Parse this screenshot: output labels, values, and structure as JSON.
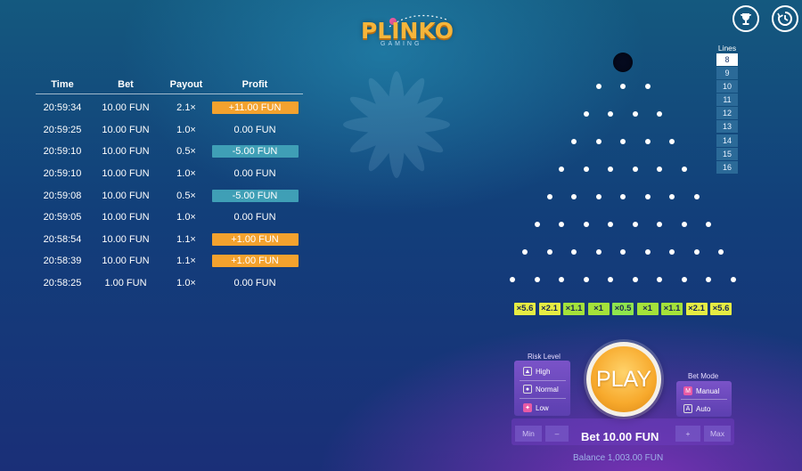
{
  "logo": {
    "title": "PLINKO",
    "subtitle": "GAMING"
  },
  "top_icons": [
    "trophy-icon",
    "history-icon"
  ],
  "history": {
    "headers": {
      "time": "Time",
      "bet": "Bet",
      "payout": "Payout",
      "profit": "Profit"
    },
    "rows": [
      {
        "time": "20:59:34",
        "bet": "10.00 FUN",
        "payout": "2.1×",
        "profit": "+11.00 FUN",
        "kind": "win"
      },
      {
        "time": "20:59:25",
        "bet": "10.00 FUN",
        "payout": "1.0×",
        "profit": "0.00 FUN",
        "kind": "none"
      },
      {
        "time": "20:59:10",
        "bet": "10.00 FUN",
        "payout": "0.5×",
        "profit": "-5.00 FUN",
        "kind": "loss"
      },
      {
        "time": "20:59:10",
        "bet": "10.00 FUN",
        "payout": "1.0×",
        "profit": "0.00 FUN",
        "kind": "none"
      },
      {
        "time": "20:59:08",
        "bet": "10.00 FUN",
        "payout": "0.5×",
        "profit": "-5.00 FUN",
        "kind": "loss"
      },
      {
        "time": "20:59:05",
        "bet": "10.00 FUN",
        "payout": "1.0×",
        "profit": "0.00 FUN",
        "kind": "none"
      },
      {
        "time": "20:58:54",
        "bet": "10.00 FUN",
        "payout": "1.1×",
        "profit": "+1.00 FUN",
        "kind": "win"
      },
      {
        "time": "20:58:39",
        "bet": "10.00 FUN",
        "payout": "1.1×",
        "profit": "+1.00 FUN",
        "kind": "win"
      },
      {
        "time": "20:58:25",
        "bet": "1.00 FUN",
        "payout": "1.0×",
        "profit": "0.00 FUN",
        "kind": "none"
      }
    ]
  },
  "board": {
    "rows": 8,
    "multipliers": [
      "×5.6",
      "×2.1",
      "×1.1",
      "×1",
      "×0.5",
      "×1",
      "×1.1",
      "×2.1",
      "×5.6"
    ]
  },
  "lines": {
    "title": "Lines",
    "options": [
      "8",
      "9",
      "10",
      "11",
      "12",
      "13",
      "14",
      "15",
      "16"
    ],
    "selected": "8"
  },
  "risk": {
    "title": "Risk Level",
    "options": [
      "High",
      "Normal",
      "Low"
    ]
  },
  "play_label": "PLAY",
  "bet_mode": {
    "title": "Bet Mode",
    "options": [
      "Manual",
      "Auto"
    ]
  },
  "controls": {
    "min": "Min",
    "minus": "–",
    "plus": "+",
    "max": "Max"
  },
  "bet_display": "Bet 10.00 FUN",
  "balance": "Balance 1,003.00 FUN",
  "colors": {
    "win": "#f3a22e",
    "loss": "#3f9fb6",
    "accent": "#f6b53a",
    "panel": "#6a48bd"
  }
}
